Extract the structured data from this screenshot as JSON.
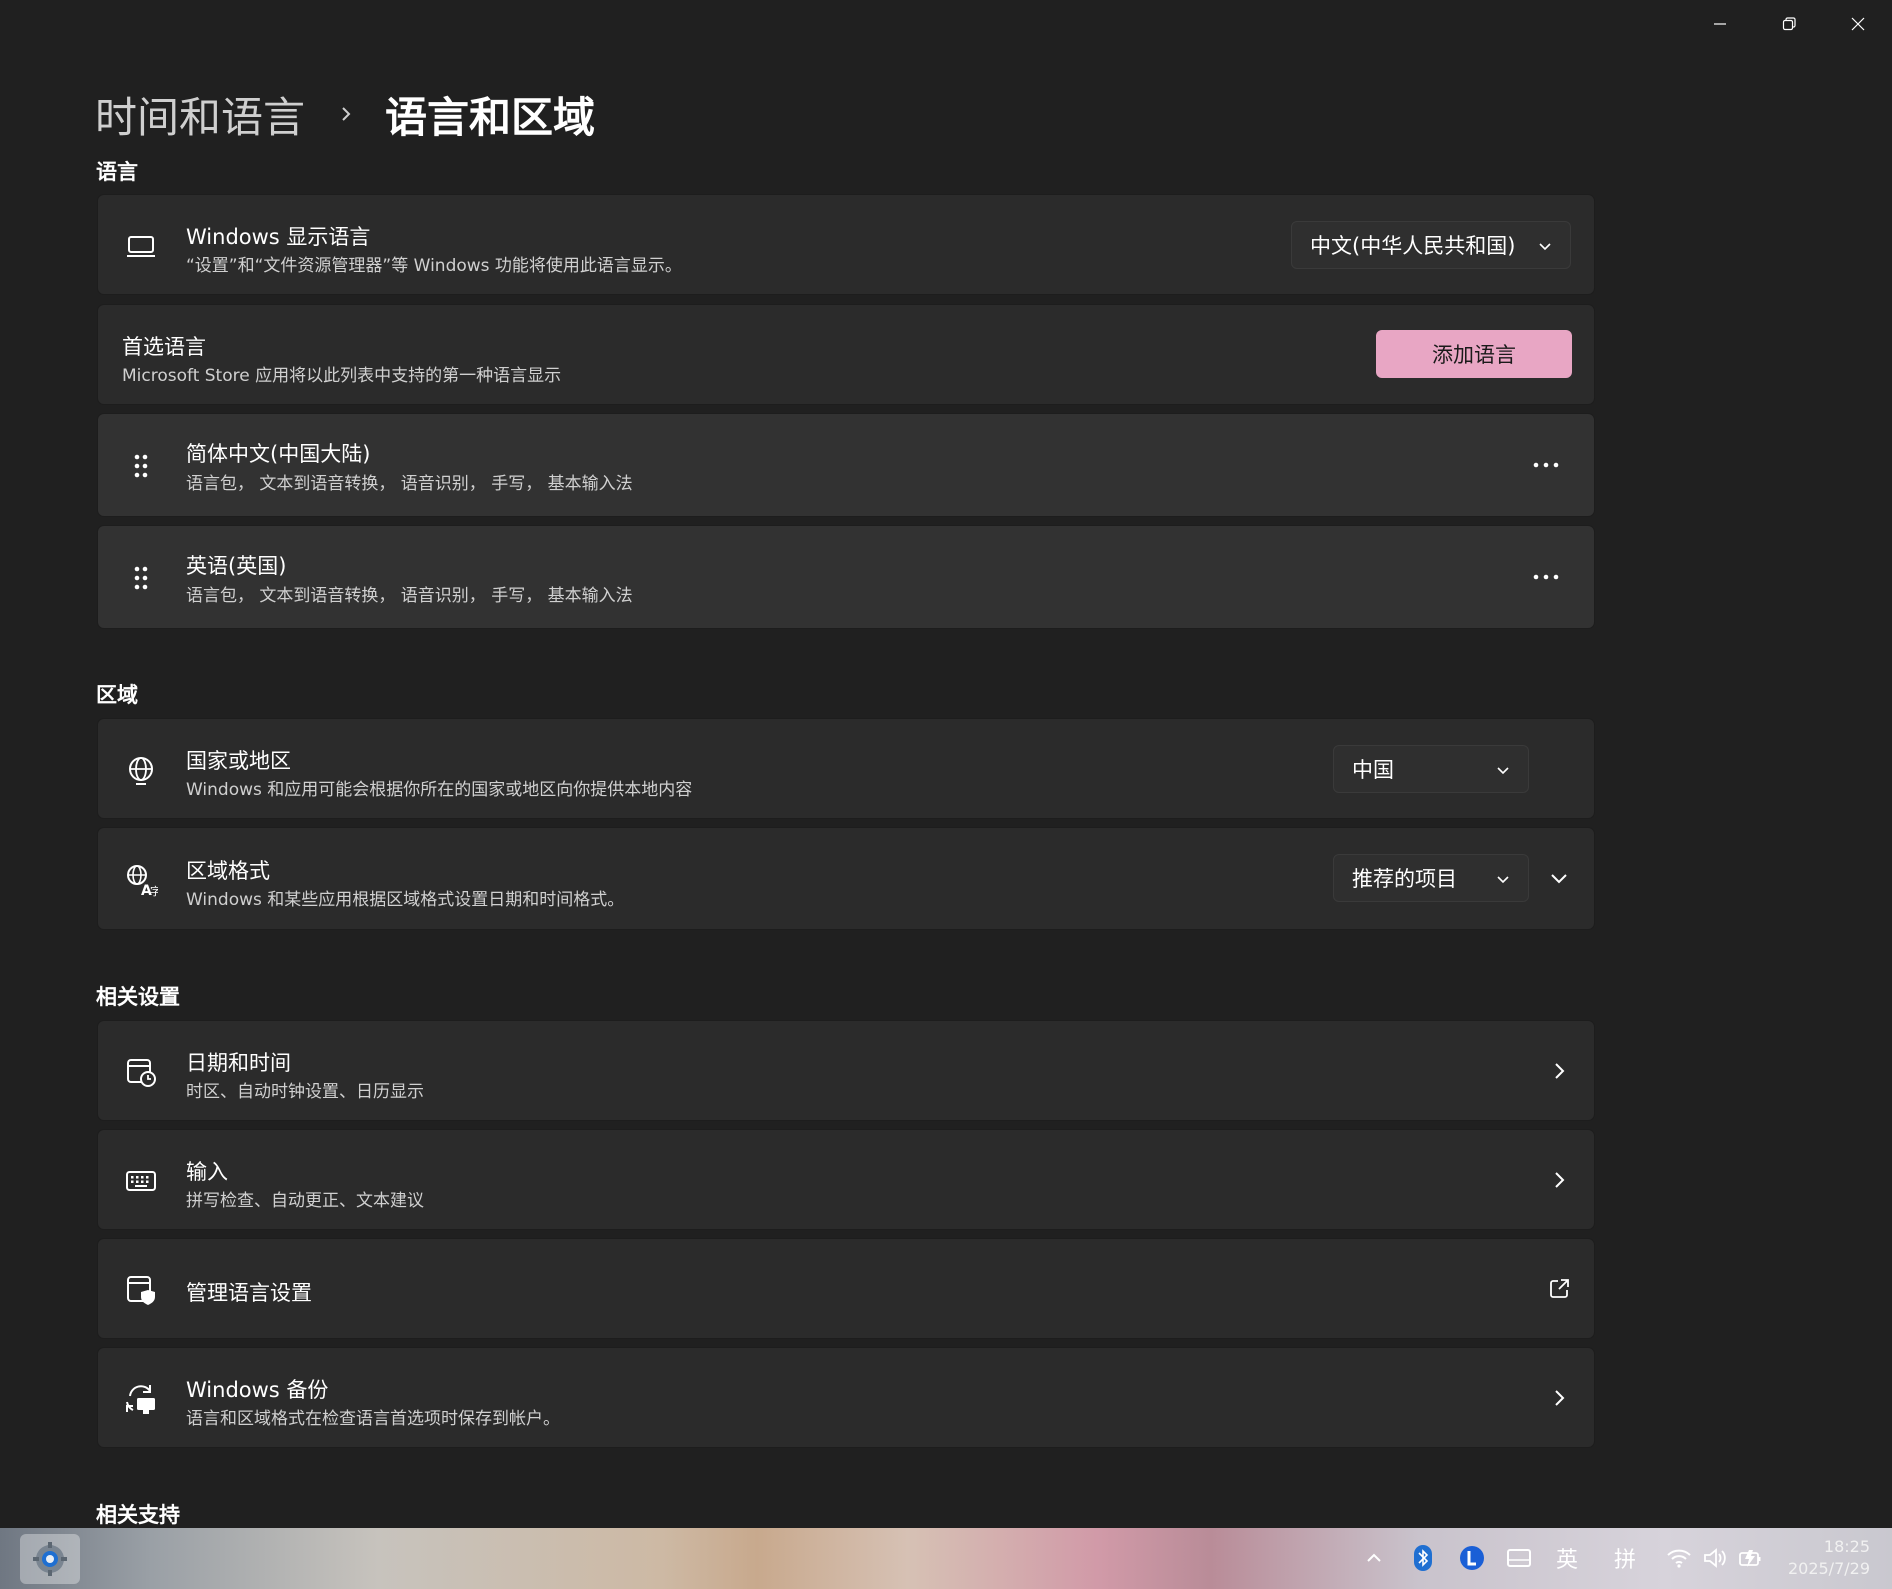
{
  "window": {
    "minimize_label": "minimize",
    "restore_label": "restore",
    "close_label": "close"
  },
  "breadcrumb": {
    "parent": "时间和语言",
    "current": "语言和区域"
  },
  "sections": {
    "language": "语言",
    "region": "区域",
    "related_settings": "相关设置",
    "related_support": "相关支持"
  },
  "display_language": {
    "title": "Windows 显示语言",
    "subtitle": "“设置”和“文件资源管理器”等 Windows 功能将使用此语言显示。",
    "selected": "中文(中华人民共和国)"
  },
  "preferred_language": {
    "title": "首选语言",
    "subtitle": "Microsoft Store 应用将以此列表中支持的第一种语言显示",
    "add_button": "添加语言"
  },
  "languages": [
    {
      "name": "简体中文(中国大陆)",
      "features": "语言包， 文本到语音转换， 语音识别， 手写， 基本输入法"
    },
    {
      "name": "英语(英国)",
      "features": "语言包， 文本到语音转换， 语音识别， 手写， 基本输入法"
    }
  ],
  "country": {
    "title": "国家或地区",
    "subtitle": "Windows 和应用可能会根据你所在的国家或地区向你提供本地内容",
    "selected": "中国"
  },
  "regional_format": {
    "title": "区域格式",
    "subtitle": "Windows 和某些应用根据区域格式设置日期和时间格式。",
    "selected": "推荐的项目"
  },
  "related": [
    {
      "title": "日期和时间",
      "subtitle": "时区、自动时钟设置、日历显示"
    },
    {
      "title": "输入",
      "subtitle": "拼写检查、自动更正、文本建议"
    },
    {
      "title": "管理语言设置",
      "subtitle": ""
    },
    {
      "title": "Windows 备份",
      "subtitle": "语言和区域格式在检查语言首选项时保存到帐户。"
    }
  ],
  "taskbar": {
    "ime_lang": "英",
    "ime_mode": "拼",
    "time": "18:25",
    "date": "2025/7/29"
  },
  "colors": {
    "background": "#202020",
    "card": "#2b2b2b",
    "accent": "#e8a6c4"
  }
}
